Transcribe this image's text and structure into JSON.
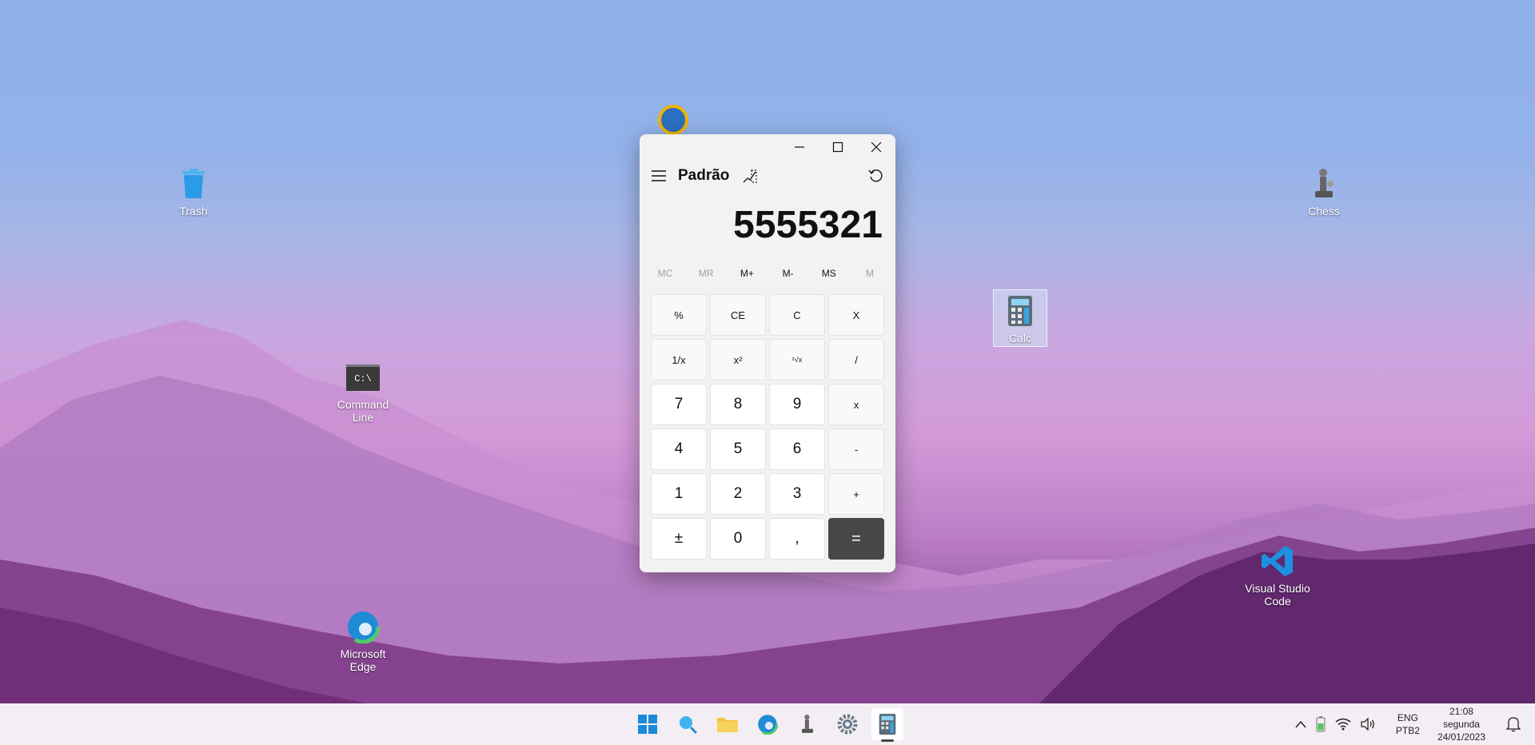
{
  "desktop": {
    "icons": [
      {
        "label": "Trash",
        "icon": "trash-icon"
      },
      {
        "label": "Chess",
        "icon": "chess-icon"
      },
      {
        "label": "Calc",
        "icon": "calculator-icon"
      },
      {
        "label": "Command\nLine",
        "icon": "terminal-icon",
        "glyph": "C:\\"
      },
      {
        "label": "Visual Studio\nCode",
        "icon": "vscode-icon"
      },
      {
        "label": "Microsoft\nEdge",
        "icon": "edge-icon"
      }
    ]
  },
  "calculator": {
    "mode_title": "Padrão",
    "display_value": "5555321",
    "memory": [
      "MC",
      "MR",
      "M+",
      "M-",
      "MS",
      "M"
    ],
    "memory_enabled": [
      false,
      false,
      true,
      true,
      true,
      false
    ],
    "keys": [
      [
        "%",
        "CE",
        "C",
        "X"
      ],
      [
        "1/x",
        "x²",
        "²√x",
        "/"
      ],
      [
        "7",
        "8",
        "9",
        "x"
      ],
      [
        "4",
        "5",
        "6",
        "-"
      ],
      [
        "1",
        "2",
        "3",
        "+"
      ],
      [
        "±",
        "0",
        ",",
        "="
      ]
    ]
  },
  "taskbar": {
    "apps": [
      "start-icon",
      "search-icon",
      "file-explorer-icon",
      "edge-icon",
      "chess-icon",
      "settings-icon",
      "calculator-icon"
    ],
    "active_app": "calculator-icon",
    "lang_line1": "ENG",
    "lang_line2": "PTB2",
    "time": "21:08",
    "day": "segunda",
    "date": "24/01/2023"
  },
  "colors": {
    "equals_key": "#474747",
    "accent_blue": "#0078d4"
  }
}
